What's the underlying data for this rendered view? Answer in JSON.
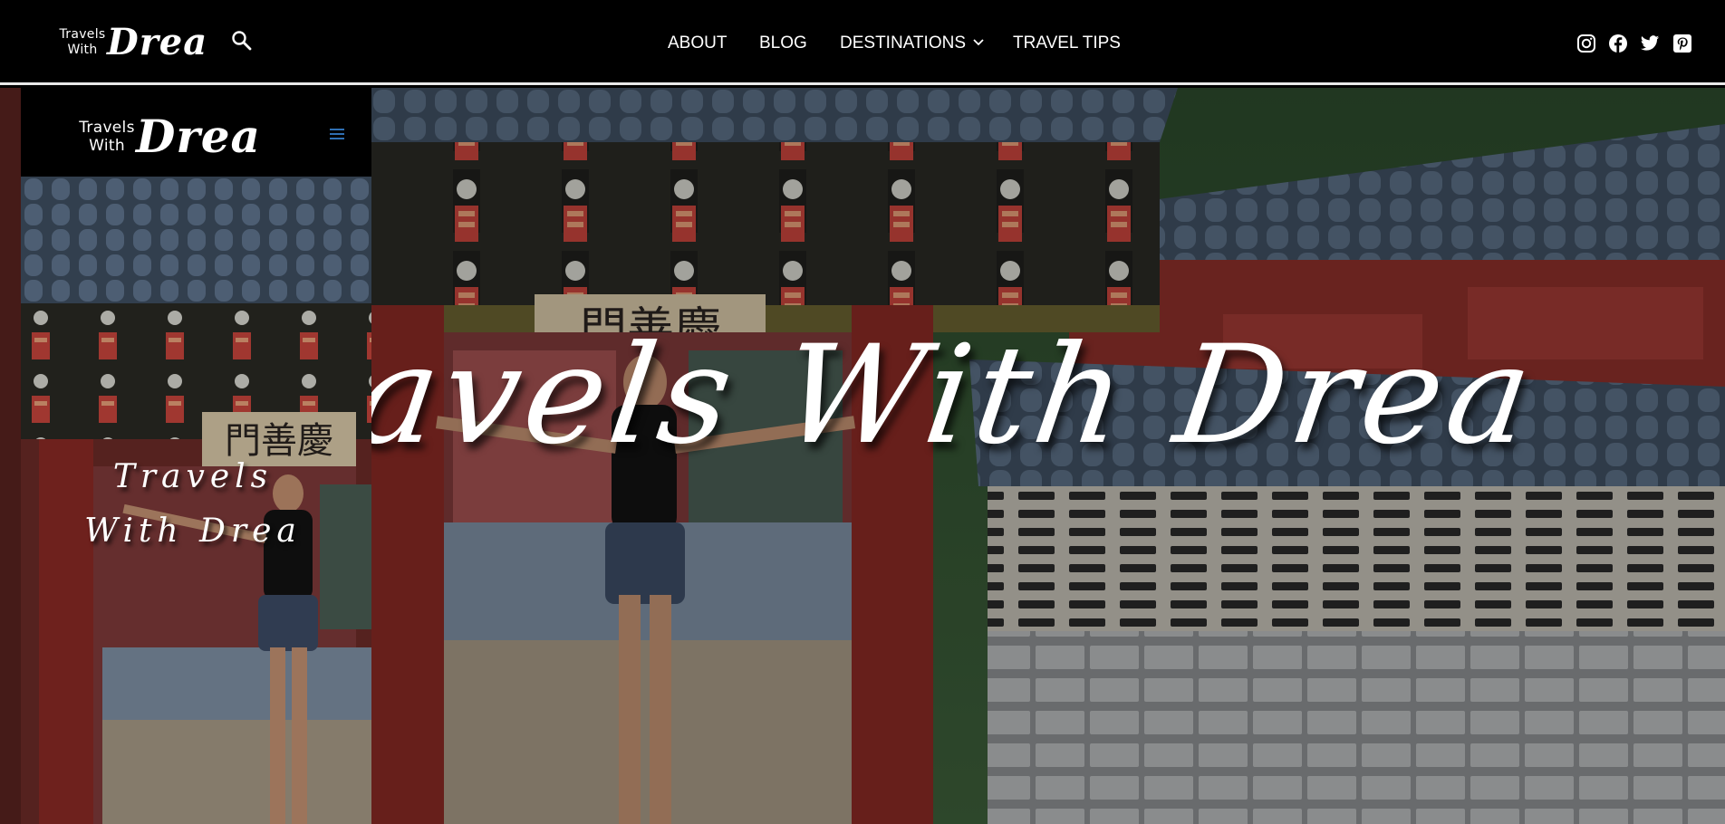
{
  "header": {
    "logo": {
      "small": "Travels With",
      "big": "Drea"
    },
    "nav": [
      {
        "label": "ABOUT"
      },
      {
        "label": "BLOG"
      },
      {
        "label": "DESTINATIONS"
      },
      {
        "label": "TRAVEL TIPS"
      }
    ],
    "search_icon": "search-icon",
    "social_icons": [
      "instagram-icon",
      "facebook-icon",
      "twitter-icon",
      "pinterest-icon"
    ]
  },
  "hero": {
    "title": "Travels With Drea"
  },
  "mobile_preview": {
    "logo": {
      "small": "Travels With",
      "big": "Drea"
    },
    "menu_icon": "hamburger-menu-icon",
    "title": "Travels With Drea"
  },
  "colors": {
    "header_bg": "#000000",
    "text": "#ffffff",
    "menu_icon": "#2f6fb3"
  }
}
